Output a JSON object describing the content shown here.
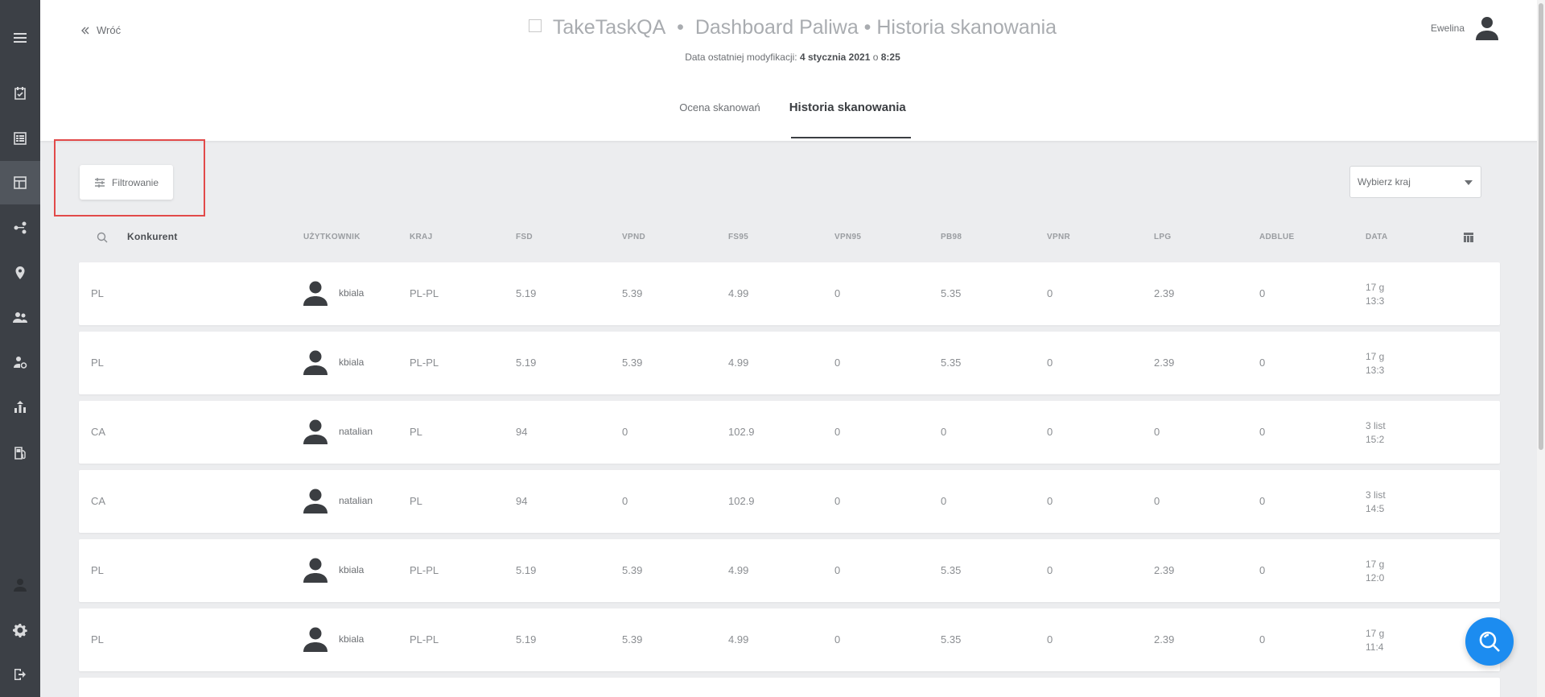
{
  "header": {
    "back_label": "Wróć",
    "app_name": "TakeTaskQA",
    "separator": "•",
    "page_title": "Dashboard Paliwa • Historia skanowania",
    "modified_prefix": "Data ostatniej modyfikacji:",
    "modified_date": "4 stycznia 2021",
    "modified_mid": "o",
    "modified_time": "8:25",
    "user_name": "Ewelina"
  },
  "tabs": [
    {
      "label": "Ocena skanowań",
      "active": false
    },
    {
      "label": "Historia skanowania",
      "active": true
    }
  ],
  "toolbar": {
    "filter_label": "Filtrowanie",
    "country_placeholder": "Wybierz kraj"
  },
  "table": {
    "columns": [
      "Konkurent",
      "UŻYTKOWNIK",
      "KRAJ",
      "FSD",
      "VPND",
      "FS95",
      "VPN95",
      "PB98",
      "VPNR",
      "LPG",
      "ADBLUE",
      "DATA"
    ],
    "rows": [
      {
        "competitor": "PL",
        "user": "kbiala",
        "country": "PL-PL",
        "fsd": "5.19",
        "vpnd": "5.39",
        "fs95": "4.99",
        "vpn95": "0",
        "pb98": "5.35",
        "vpnr": "0",
        "lpg": "2.39",
        "adblue": "0",
        "date1": "17 g",
        "date2": "13:3"
      },
      {
        "competitor": "PL",
        "user": "kbiala",
        "country": "PL-PL",
        "fsd": "5.19",
        "vpnd": "5.39",
        "fs95": "4.99",
        "vpn95": "0",
        "pb98": "5.35",
        "vpnr": "0",
        "lpg": "2.39",
        "adblue": "0",
        "date1": "17 g",
        "date2": "13:3"
      },
      {
        "competitor": "CA",
        "user": "natalian",
        "country": "PL",
        "fsd": "94",
        "vpnd": "0",
        "fs95": "102.9",
        "vpn95": "0",
        "pb98": "0",
        "vpnr": "0",
        "lpg": "0",
        "adblue": "0",
        "date1": "3 list",
        "date2": "15:2"
      },
      {
        "competitor": "CA",
        "user": "natalian",
        "country": "PL",
        "fsd": "94",
        "vpnd": "0",
        "fs95": "102.9",
        "vpn95": "0",
        "pb98": "0",
        "vpnr": "0",
        "lpg": "0",
        "adblue": "0",
        "date1": "3 list",
        "date2": "14:5"
      },
      {
        "competitor": "PL",
        "user": "kbiala",
        "country": "PL-PL",
        "fsd": "5.19",
        "vpnd": "5.39",
        "fs95": "4.99",
        "vpn95": "0",
        "pb98": "5.35",
        "vpnr": "0",
        "lpg": "2.39",
        "adblue": "0",
        "date1": "17 g",
        "date2": "12:0"
      },
      {
        "competitor": "PL",
        "user": "kbiala",
        "country": "PL-PL",
        "fsd": "5.19",
        "vpnd": "5.39",
        "fs95": "4.99",
        "vpn95": "0",
        "pb98": "5.35",
        "vpnr": "0",
        "lpg": "2.39",
        "adblue": "0",
        "date1": "17 g",
        "date2": "11:4"
      }
    ]
  },
  "sidebar": {
    "items": [
      "menu-icon",
      "tasks-icon",
      "list-icon",
      "dashboard-icon",
      "share-icon",
      "location-icon",
      "users-icon",
      "user-settings-icon",
      "reports-icon",
      "fuel-icon",
      "profile-icon",
      "gear-icon",
      "logout-icon"
    ]
  },
  "colors": {
    "sidebar_bg": "#3c4046",
    "accent_blue": "#1c8cf0",
    "highlight_red": "#e24a4a",
    "page_bg": "#ecedef"
  }
}
